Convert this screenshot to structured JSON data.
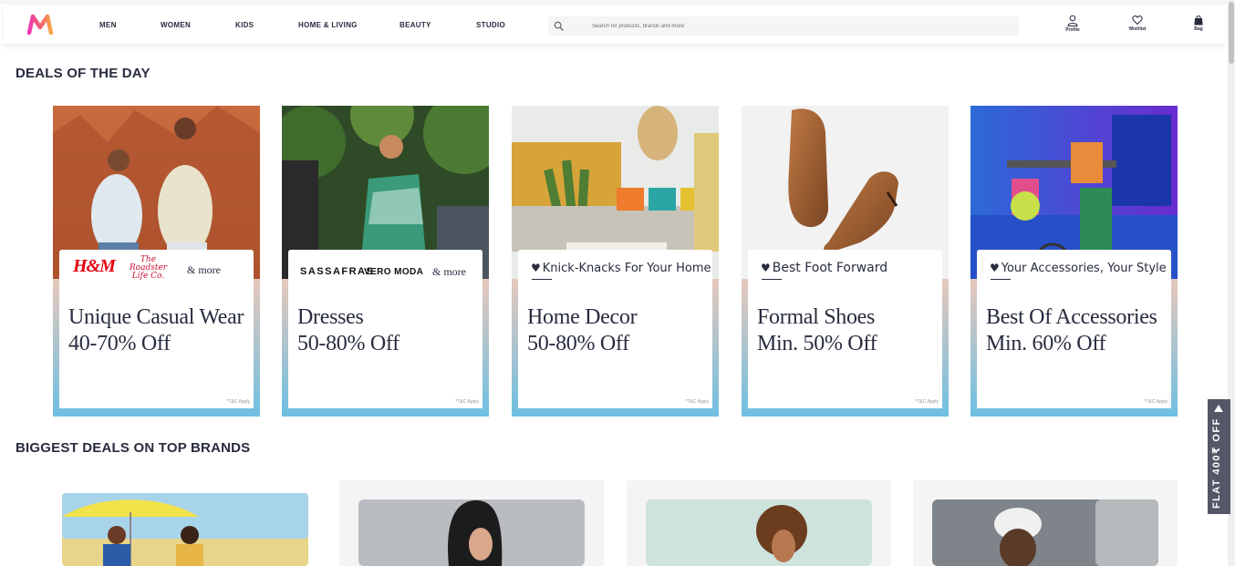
{
  "header": {
    "nav": [
      "MEN",
      "WOMEN",
      "KIDS",
      "HOME & LIVING",
      "BEAUTY",
      "STUDIO"
    ],
    "search_placeholder": "Search for products, brands and more",
    "actions": {
      "profile": "Profile",
      "wishlist": "Wishlist",
      "bag": "Bag"
    }
  },
  "sections": {
    "deals_title": "DEALS OF THE DAY",
    "brands_title": "BIGGEST DEALS ON TOP BRANDS"
  },
  "deals": [
    {
      "brands_more": "& more",
      "brand_a": "H&M",
      "brand_b": "The Roadster Life Co.",
      "title_line1": "Unique Casual Wear",
      "title_line2": "40-70% Off",
      "tnc": "*T&C Apply"
    },
    {
      "brands_more": "& more",
      "brand_a": "SASSAFRAS",
      "brand_b": "VERO MODA",
      "title_line1": "Dresses",
      "title_line2": "50-80% Off",
      "tnc": "*T&C Apply"
    },
    {
      "tagline": "Knick-Knacks For Your Home",
      "title_line1": "Home Decor",
      "title_line2": "50-80% Off",
      "tnc": "*T&C Apply"
    },
    {
      "tagline": "Best Foot Forward",
      "title_line1": "Formal Shoes",
      "title_line2": "Min. 50% Off",
      "tnc": "*T&C Apply"
    },
    {
      "tagline": "Your Accessories, Your Style",
      "title_line1": "Best Of Accessories",
      "title_line2": "Min. 60% Off",
      "tnc": "*T&C Apply"
    }
  ],
  "side_offer": {
    "text": "FLAT 400₹ OFF"
  },
  "colors": {
    "brand_pink": "#ff3f6c",
    "brand_orange": "#f8a544",
    "text_dark": "#282c3f",
    "offer_bg": "#535766"
  },
  "icons": [
    "myntra-logo",
    "search-icon",
    "profile-icon",
    "wishlist-heart-icon",
    "bag-icon",
    "heart-icon",
    "arrow-left-icon"
  ]
}
